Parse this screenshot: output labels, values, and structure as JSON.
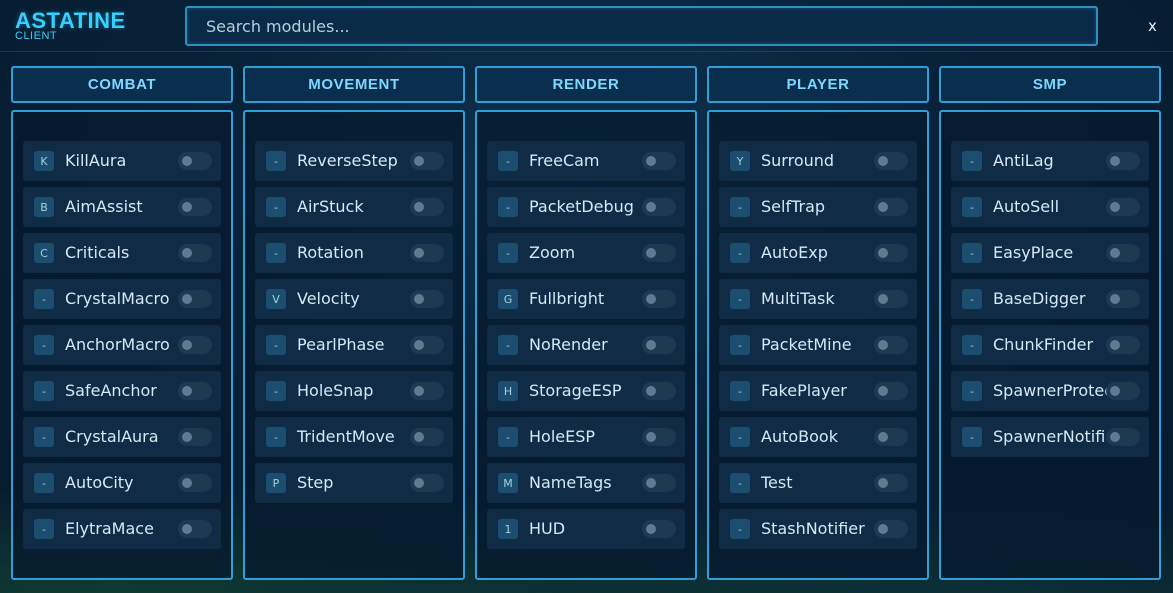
{
  "app": {
    "title": "ASTATINE",
    "subtitle": "CLIENT",
    "search_placeholder": "Search modules...",
    "close_label": "x"
  },
  "categories": [
    {
      "name": "COMBAT",
      "modules": [
        {
          "key": "K",
          "name": "KillAura",
          "enabled": false
        },
        {
          "key": "B",
          "name": "AimAssist",
          "enabled": false
        },
        {
          "key": "C",
          "name": "Criticals",
          "enabled": false
        },
        {
          "key": "-",
          "name": "CrystalMacro",
          "enabled": false
        },
        {
          "key": "-",
          "name": "AnchorMacro",
          "enabled": false
        },
        {
          "key": "-",
          "name": "SafeAnchor",
          "enabled": false
        },
        {
          "key": "-",
          "name": "CrystalAura",
          "enabled": false
        },
        {
          "key": "-",
          "name": "AutoCity",
          "enabled": false
        },
        {
          "key": "-",
          "name": "ElytraMace",
          "enabled": false
        }
      ]
    },
    {
      "name": "MOVEMENT",
      "modules": [
        {
          "key": "-",
          "name": "ReverseStep",
          "enabled": false
        },
        {
          "key": "-",
          "name": "AirStuck",
          "enabled": false
        },
        {
          "key": "-",
          "name": "Rotation",
          "enabled": false
        },
        {
          "key": "V",
          "name": "Velocity",
          "enabled": false
        },
        {
          "key": "-",
          "name": "PearlPhase",
          "enabled": false
        },
        {
          "key": "-",
          "name": "HoleSnap",
          "enabled": false
        },
        {
          "key": "-",
          "name": "TridentMove",
          "enabled": false
        },
        {
          "key": "P",
          "name": "Step",
          "enabled": false
        }
      ]
    },
    {
      "name": "RENDER",
      "modules": [
        {
          "key": "-",
          "name": "FreeCam",
          "enabled": false
        },
        {
          "key": "-",
          "name": "PacketDebug",
          "enabled": false
        },
        {
          "key": "-",
          "name": "Zoom",
          "enabled": false
        },
        {
          "key": "G",
          "name": "Fullbright",
          "enabled": false
        },
        {
          "key": "-",
          "name": "NoRender",
          "enabled": false
        },
        {
          "key": "H",
          "name": "StorageESP",
          "enabled": false
        },
        {
          "key": "-",
          "name": "HoleESP",
          "enabled": false
        },
        {
          "key": "M",
          "name": "NameTags",
          "enabled": false
        },
        {
          "key": "1",
          "name": "HUD",
          "enabled": false
        }
      ]
    },
    {
      "name": "PLAYER",
      "modules": [
        {
          "key": "Y",
          "name": "Surround",
          "enabled": false
        },
        {
          "key": "-",
          "name": "SelfTrap",
          "enabled": false
        },
        {
          "key": "-",
          "name": "AutoExp",
          "enabled": false
        },
        {
          "key": "-",
          "name": "MultiTask",
          "enabled": false
        },
        {
          "key": "-",
          "name": "PacketMine",
          "enabled": false
        },
        {
          "key": "-",
          "name": "FakePlayer",
          "enabled": false
        },
        {
          "key": "-",
          "name": "AutoBook",
          "enabled": false
        },
        {
          "key": "-",
          "name": "Test",
          "enabled": false
        },
        {
          "key": "-",
          "name": "StashNotifier",
          "enabled": false
        }
      ]
    },
    {
      "name": "SMP",
      "modules": [
        {
          "key": "-",
          "name": "AntiLag",
          "enabled": false
        },
        {
          "key": "-",
          "name": "AutoSell",
          "enabled": false
        },
        {
          "key": "-",
          "name": "EasyPlace",
          "enabled": false
        },
        {
          "key": "-",
          "name": "BaseDigger",
          "enabled": false
        },
        {
          "key": "-",
          "name": "ChunkFinder",
          "enabled": false
        },
        {
          "key": "-",
          "name": "SpawnerProtect",
          "enabled": false
        },
        {
          "key": "-",
          "name": "SpawnerNotifier",
          "enabled": false
        }
      ]
    }
  ],
  "colors": {
    "accent": "#35d0ff",
    "border": "#2f9fd9",
    "background": "#082239"
  }
}
